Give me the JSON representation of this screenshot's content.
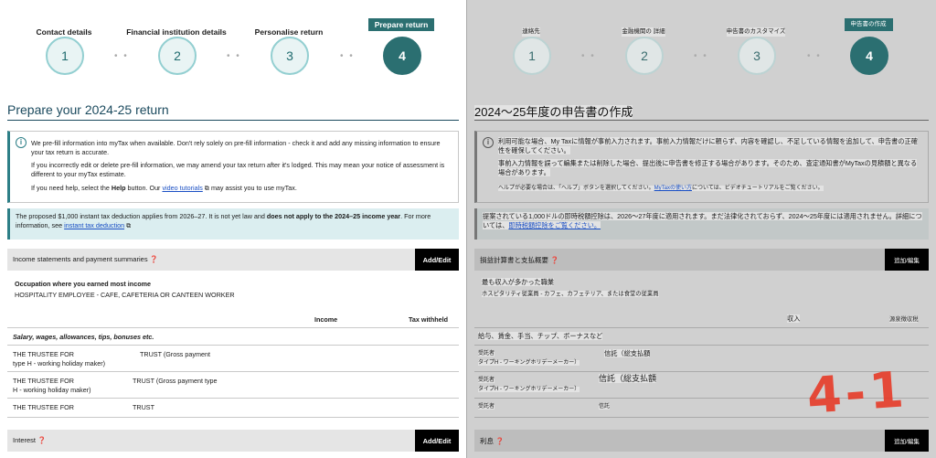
{
  "left": {
    "steps": [
      {
        "num": "1",
        "label": "Contact details"
      },
      {
        "num": "2",
        "label": "Financial institution details"
      },
      {
        "num": "3",
        "label": "Personalise return"
      },
      {
        "num": "4",
        "label": "Prepare return"
      }
    ],
    "title": "Prepare your 2024-25 return",
    "info": {
      "p1": "We pre-fill information into myTax when available. Don't rely solely on pre-fill information - check it and add any missing information to ensure your tax return is accurate.",
      "p2": "If you incorrectly edit or delete pre-fill information, we may amend your tax return after it's lodged. This may mean your notice of assessment is different to your myTax estimate.",
      "p3a": "If you need help, select the ",
      "p3help": "Help",
      "p3b": " button. Our ",
      "p3link": "video tutorials",
      "p3c": " may assist you to use myTax."
    },
    "notice": {
      "a": "The proposed $1,000 instant tax deduction applies from 2026–27. It is not yet law and ",
      "bold": "does not apply to the 2024–25 income year",
      "b": ". For more information, see ",
      "link": "instant tax deduction"
    },
    "income_section": {
      "title": "Income statements and payment summaries",
      "button": "Add/Edit",
      "occupation_label": "Occupation where you earned most income",
      "occupation_value": "HOSPITALITY EMPLOYEE - CAFE, CAFETERIA OR CANTEEN WORKER",
      "col_income": "Income",
      "col_tax": "Tax withheld",
      "category": "Salary, wages, allowances, tips, bonuses etc.",
      "rows": [
        {
          "a": "THE TRUSTEE FOR",
          "b": "TRUST (Gross payment",
          "c": "type H - working holiday maker)"
        },
        {
          "a": "THE TRUSTEE FOR",
          "b": "TRUST (Gross payment type",
          "c": "H - working holiday maker)"
        },
        {
          "a": "THE TRUSTEE FOR",
          "b": "TRUST",
          "c": ""
        }
      ]
    },
    "interest": {
      "title": "Interest",
      "button": "Add/Edit"
    }
  },
  "right": {
    "steps": [
      {
        "num": "1",
        "label": "連絡先"
      },
      {
        "num": "2",
        "label": "金融機関の 詳細"
      },
      {
        "num": "3",
        "label": "申告書のカスタマイズ"
      },
      {
        "num": "4",
        "label": "申告書の作成"
      }
    ],
    "title": "2024〜25年度の申告書の作成",
    "info": {
      "p1": "利用可能な場合、My Taxに情報が事前入力されます。事前入力情報だけに頼らず、内容を確認し、不足している情報を追加して、申告書の正確性を確保してください。",
      "p2": "事前入力情報を誤って編集または削除した場合、提出後に申告書を修正する場合があります。そのため、査定通知書がMyTaxの見積額と異なる場合があります。",
      "p3a": "ヘルプが必要な場合は、「ヘルプ」ボタンを選択してください。",
      "p3link": "MyTaxの使い方",
      "p3b": "については、ビデオチュートリアルをご覧ください。"
    },
    "notice": {
      "a": "提案されている1,000ドルの即時税額控除は、2026〜27年度に適用されます。まだ法律化されておらず、2024〜25年度には適用されません。詳細については、",
      "link": "即時税額控除をご覧ください。"
    },
    "income_section": {
      "title": "損益計算書と支払概要",
      "button": "追加/編集",
      "occupation_label": "最も収入が多かった職業",
      "occupation_value": "ホスピタリティ従業員 - カフェ、カフェテリア、または食堂の従業員",
      "col_income": "収入",
      "col_tax": "源泉徴収税",
      "category": "給与、賃金、手当、チップ、ボーナスなど",
      "rows": [
        {
          "a": "受託者",
          "b": "信託（総支払額",
          "c": "タイプH - ワーキングホリデーメーカー）"
        },
        {
          "a": "受託者",
          "b": "信託（総支払額",
          "c": "タイプH - ワーキングホリデーメーカー）"
        },
        {
          "a": "受託者",
          "b": "信託",
          "c": ""
        }
      ]
    },
    "interest": {
      "title": "利息",
      "button": "追加/編集"
    },
    "watermark": "4-1"
  },
  "colors": {
    "accent": "#2b6f71",
    "link": "#1a4fc4",
    "watermark": "#e8321e"
  }
}
